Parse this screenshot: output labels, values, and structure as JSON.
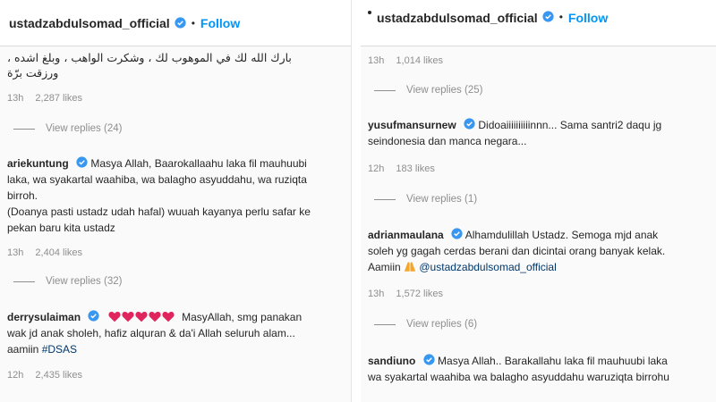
{
  "left": {
    "header": {
      "username": "ustadzabdulsomad_official",
      "follow": "Follow"
    },
    "arabic_text": "بارك الله لك في الموهوب لك ، وشكرت الواهب ، وبلغ اشده ، ورزقت برّة",
    "c0": {
      "time": "13h",
      "likes": "2,287 likes",
      "replies": "View replies (24)"
    },
    "c1": {
      "username": "ariekuntung",
      "text1": "Masya Allah, Baarokallaahu laka fil mauhuubi",
      "text2": "laka, wa syakartal waahiba, wa balagho asyuddahu, wa ruziqta",
      "text3": "birroh.",
      "text4": "(Doanya pasti ustadz udah hafal) wuuah kayanya perlu safar ke",
      "text5": "pekan baru kita ustadz",
      "time": "13h",
      "likes": "2,404 likes",
      "replies": "View replies (32)"
    },
    "c2": {
      "username": "derrysulaiman",
      "text1": "MasyAllah, smg panakan",
      "text2": "wak jd anak sholeh, hafiz alquran & da'i Allah seluruh alam...",
      "text3": "aamiin",
      "hashtag": "#DSAS",
      "time": "12h",
      "likes": "2,435 likes"
    }
  },
  "right": {
    "header": {
      "username": "ustadzabdulsomad_official",
      "follow": "Follow"
    },
    "c0": {
      "time": "13h",
      "likes": "1,014 likes",
      "replies": "View replies (25)"
    },
    "c1": {
      "username": "yusufmansurnew",
      "text1": "Didoaiiiiiiiiiinnn... Sama santri2 daqu jg",
      "text2": "seindonesia dan manca negara...",
      "time": "12h",
      "likes": "183 likes",
      "replies": "View replies (1)"
    },
    "c2": {
      "username": "adrianmaulana",
      "text1": "Alhamdulillah Ustadz. Semoga mjd anak",
      "text2": "soleh yg gagah cerdas berani dan dicintai orang banyak kelak.",
      "text3": "Aamiin",
      "mention": "@ustadzabdulsomad_official",
      "time": "13h",
      "likes": "1,572 likes",
      "replies": "View replies (6)"
    },
    "c3": {
      "username": "sandiuno",
      "text1": "Masya Allah.. Barakallahu laka fil mauhuubi laka",
      "text2": "wa syakartal waahiba wa balagho asyuddahu waruziqta birrohu"
    }
  },
  "colors": {
    "link": "#0095f6",
    "verified": "#3897f0",
    "heart": "#e0245e",
    "meta": "#8e8e8e"
  }
}
